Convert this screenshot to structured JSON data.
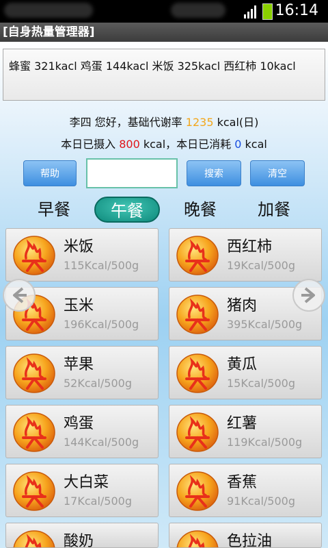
{
  "status_bar": {
    "time": "16:14"
  },
  "app": {
    "title": "[自身热量管理器]"
  },
  "summary_text": "蜂蜜 321kacl  鸡蛋 144kacl  米饭 325kacl  西红柿 10kacl",
  "greeting": {
    "prefix": "李四 您好，基础代谢率 ",
    "value": "1235",
    "suffix": " kcal(日)"
  },
  "intake": {
    "prefix": "本日已摄入 ",
    "taken": "800",
    "middle": " kcal，本日已消耗 ",
    "burned": "0",
    "suffix": " kcal"
  },
  "toolbar": {
    "help": "帮助",
    "search_value": "",
    "search": "搜索",
    "clear": "清空"
  },
  "meals": [
    "早餐",
    "午餐",
    "晚餐",
    "加餐"
  ],
  "active_meal": "午餐",
  "foods": [
    {
      "name": "米饭",
      "kcal": "115Kcal/500g"
    },
    {
      "name": "西红柿",
      "kcal": "19Kcal/500g"
    },
    {
      "name": "玉米",
      "kcal": "196Kcal/500g"
    },
    {
      "name": "猪肉",
      "kcal": "395Kcal/500g"
    },
    {
      "name": "苹果",
      "kcal": "52Kcal/500g"
    },
    {
      "name": "黄瓜",
      "kcal": "15Kcal/500g"
    },
    {
      "name": "鸡蛋",
      "kcal": "144Kcal/500g"
    },
    {
      "name": "红薯",
      "kcal": "119Kcal/500g"
    },
    {
      "name": "大白菜",
      "kcal": "17Kcal/500g"
    },
    {
      "name": "香蕉",
      "kcal": "91Kcal/500g"
    },
    {
      "name": "酸奶",
      "kcal": ""
    },
    {
      "name": "色拉油",
      "kcal": ""
    }
  ],
  "colors": {
    "accent": "#3e8fe0",
    "active_tab": "#14a090",
    "highlight_orange": "#f3a61b",
    "highlight_red": "#e0141a",
    "highlight_blue": "#1a4fe0"
  }
}
